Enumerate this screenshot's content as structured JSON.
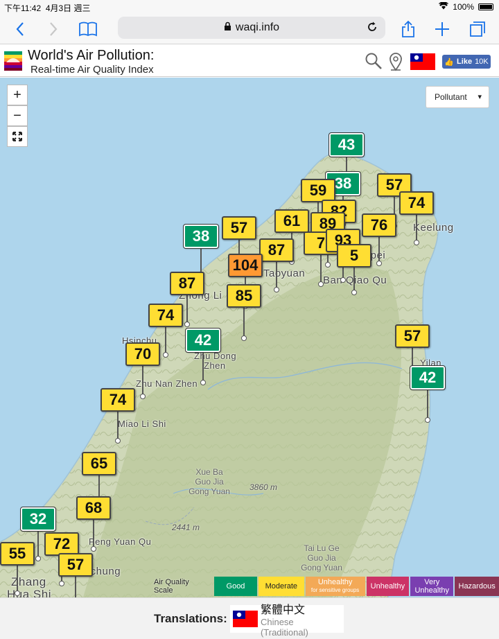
{
  "status": {
    "time": "下午11:42",
    "date": "4月3日 週三",
    "battery": "100%"
  },
  "browser": {
    "url": "waqi.info"
  },
  "header": {
    "title": "World's Air Pollution:",
    "subtitle": "Real-time Air Quality Index",
    "like_label": "Like",
    "like_count": "10K"
  },
  "map": {
    "zoom_in": "+",
    "zoom_out": "−",
    "pollutant_label": "Pollutant",
    "cities": [
      {
        "name": "Keelung"
      },
      {
        "name": "Taoyuan"
      },
      {
        "name": "Ban Qiao Qu"
      },
      {
        "name": "Zhong Li"
      },
      {
        "name": "Hsinchu"
      },
      {
        "name": "Zhu Dong"
      },
      {
        "name": "Zhen"
      },
      {
        "name": "Zhu Nan Zhen"
      },
      {
        "name": "Miao Li Shi"
      },
      {
        "name": "Peng Yuan Qu"
      },
      {
        "name": "Taichung"
      },
      {
        "name": "Zhang"
      },
      {
        "name": "Hua Shi"
      },
      {
        "name": "Yilan"
      },
      {
        "name": "Taipei"
      }
    ],
    "peaks": [
      {
        "label": "3860 m"
      },
      {
        "label": "2441 m"
      }
    ],
    "regions": [
      {
        "l1": "Xue Ba",
        "l2": "Guo Jia",
        "l3": "Gong Yuan"
      },
      {
        "l1": "Tai Lu Ge",
        "l2": "Guo Jia",
        "l3": "Gong Yuan"
      }
    ],
    "markers": [
      {
        "v": "43",
        "level": "good"
      },
      {
        "v": "38",
        "level": "good"
      },
      {
        "v": "57",
        "level": "moderate"
      },
      {
        "v": "74",
        "level": "moderate"
      },
      {
        "v": "59",
        "level": "moderate"
      },
      {
        "v": "82",
        "level": "moderate"
      },
      {
        "v": "61",
        "level": "moderate"
      },
      {
        "v": "89",
        "level": "moderate"
      },
      {
        "v": "76",
        "level": "moderate"
      },
      {
        "v": "38",
        "level": "good"
      },
      {
        "v": "57",
        "level": "moderate"
      },
      {
        "v": "7",
        "level": "moderate"
      },
      {
        "v": "93",
        "level": "moderate"
      },
      {
        "v": "87",
        "level": "moderate"
      },
      {
        "v": "104",
        "level": "usg"
      },
      {
        "v": "5",
        "level": "moderate"
      },
      {
        "v": "87",
        "level": "moderate"
      },
      {
        "v": "85",
        "level": "moderate"
      },
      {
        "v": "74",
        "level": "moderate"
      },
      {
        "v": "42",
        "level": "good"
      },
      {
        "v": "70",
        "level": "moderate"
      },
      {
        "v": "57",
        "level": "moderate"
      },
      {
        "v": "42",
        "level": "good"
      },
      {
        "v": "74",
        "level": "moderate"
      },
      {
        "v": "65",
        "level": "moderate"
      },
      {
        "v": "68",
        "level": "moderate"
      },
      {
        "v": "32",
        "level": "good"
      },
      {
        "v": "72",
        "level": "moderate"
      },
      {
        "v": "55",
        "level": "moderate"
      },
      {
        "v": "57",
        "level": "moderate"
      }
    ]
  },
  "legend": {
    "title": "Air Quality Scale",
    "levels": [
      {
        "label": "Good",
        "sub": "",
        "color": "#009966"
      },
      {
        "label": "Moderate",
        "sub": "",
        "color": "#ffde33"
      },
      {
        "label": "Unhealthy",
        "sub": "for sensitive groups",
        "color": "#ff9933"
      },
      {
        "label": "Unhealthy",
        "sub": "",
        "color": "#cc0033"
      },
      {
        "label": "Very",
        "sub": "Unhealthy",
        "color": "#660099"
      },
      {
        "label": "Hazardous",
        "sub": "",
        "color": "#7e0023"
      }
    ]
  },
  "footer": {
    "translations_label": "Translations:",
    "lang_native": "繁體中文",
    "lang_en": "Chinese (Traditional)"
  }
}
